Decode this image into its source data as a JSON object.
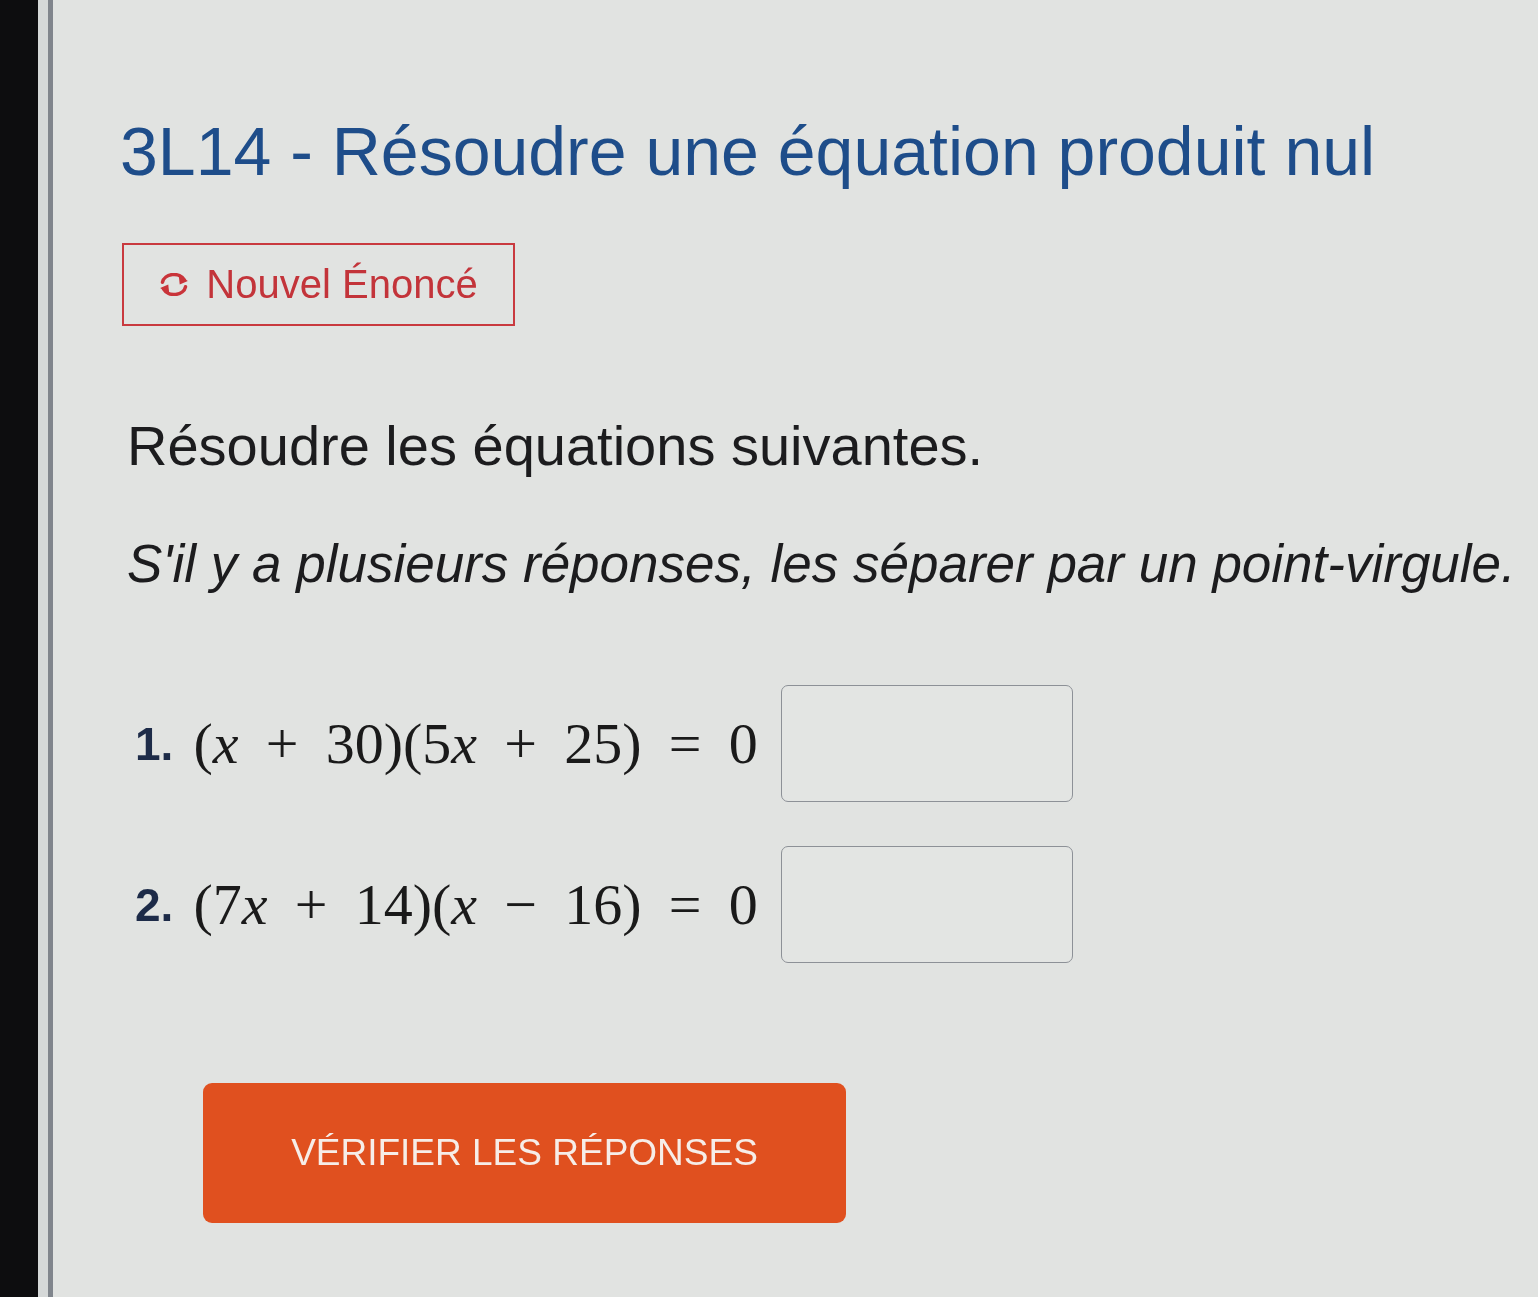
{
  "title": "3L14 - Résoudre une équation produit nul",
  "new_statement_button": {
    "label": "Nouvel Énoncé"
  },
  "instruction": "Résoudre les équations suivantes.",
  "note": "S'il y a plusieurs réponses, les séparer par un point-virgule.",
  "exercises": [
    {
      "number": "1.",
      "equation": [
        {
          "kind": "text",
          "text": "("
        },
        {
          "kind": "variable",
          "text": "x"
        },
        {
          "kind": "text",
          "text": " + 30)(5"
        },
        {
          "kind": "variable",
          "text": "x"
        },
        {
          "kind": "text",
          "text": " + 25) = 0"
        }
      ]
    },
    {
      "number": "2.",
      "equation": [
        {
          "kind": "text",
          "text": "(7"
        },
        {
          "kind": "variable",
          "text": "x"
        },
        {
          "kind": "text",
          "text": " + 14)("
        },
        {
          "kind": "variable",
          "text": "x"
        },
        {
          "kind": "text",
          "text": " − 16) = 0"
        }
      ]
    }
  ],
  "check_button": {
    "label": "VÉRIFIER LES RÉPONSES"
  }
}
